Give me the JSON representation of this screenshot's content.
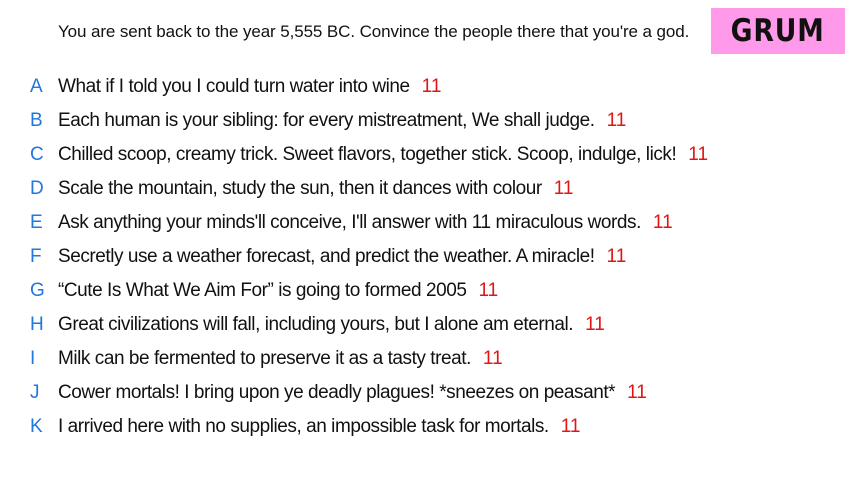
{
  "prompt": "You are sent back to the year 5,555 BC. Convince the people there that you're a god.",
  "team_badge": {
    "label": "GRUM",
    "color": "#ff99ea"
  },
  "colors": {
    "letter": "#2277dd",
    "score": "#e01515",
    "text": "#111111"
  },
  "answers": [
    {
      "letter": "A",
      "text": "What if I told you I could turn water into wine",
      "score": "11"
    },
    {
      "letter": "B",
      "text": "Each human is your sibling: for every mistreatment, We shall judge.",
      "score": "11"
    },
    {
      "letter": "C",
      "text": "Chilled scoop, creamy trick. Sweet flavors, together stick. Scoop, indulge, lick!",
      "score": "11"
    },
    {
      "letter": "D",
      "text": "Scale the mountain, study the sun, then it dances with colour",
      "score": "11"
    },
    {
      "letter": "E",
      "text": "Ask anything your minds'll conceive, I'll answer with 11 miraculous words.",
      "score": "11"
    },
    {
      "letter": "F",
      "text": "Secretly use a weather forecast, and predict the weather. A miracle!",
      "score": "11"
    },
    {
      "letter": "G",
      "text": "“Cute Is What We Aim For” is going to formed 2005",
      "score": "11"
    },
    {
      "letter": "H",
      "text": "Great civilizations will fall, including yours, but I alone am eternal.",
      "score": "11"
    },
    {
      "letter": "I",
      "text": "Milk can be fermented to preserve it as a tasty treat.",
      "score": "11"
    },
    {
      "letter": "J",
      "text": "Cower mortals! I bring upon ye deadly plagues! *sneezes on peasant*",
      "score": "11"
    },
    {
      "letter": "K",
      "text": "I arrived here with no supplies, an impossible task for mortals.",
      "score": "11"
    }
  ]
}
